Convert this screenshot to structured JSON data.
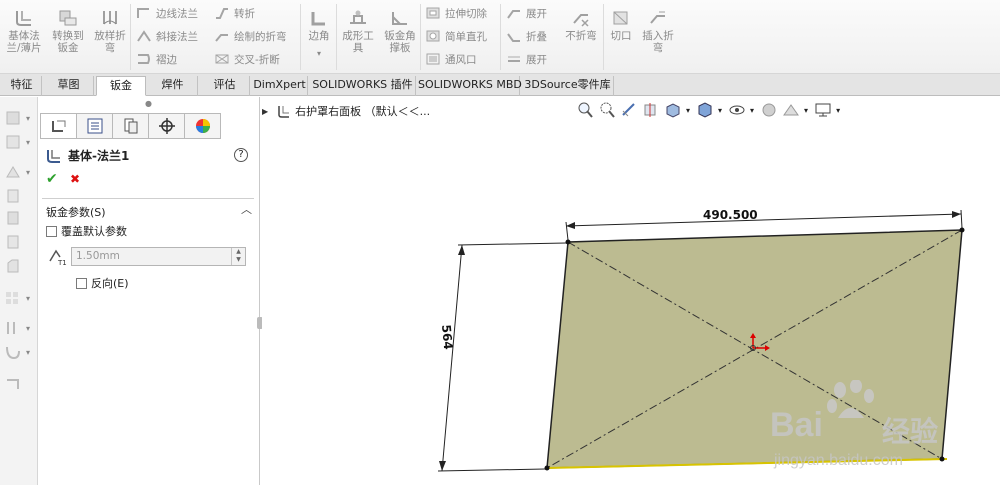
{
  "ribbon": {
    "big": [
      {
        "key": "base_flange",
        "label": "基体法\n兰/薄片"
      },
      {
        "key": "convert",
        "label": "转换到\n钣金"
      },
      {
        "key": "lofted",
        "label": "放样折\n弯"
      },
      {
        "key": "corners",
        "label": "边角"
      },
      {
        "key": "forming",
        "label": "成形工\n具"
      },
      {
        "key": "gusset",
        "label": "钣金角\n撑板"
      },
      {
        "key": "no_bends",
        "label": "不折弯"
      },
      {
        "key": "rip",
        "label": "切口"
      },
      {
        "key": "insert_bends",
        "label": "插入折\n弯"
      }
    ],
    "small": [
      {
        "key": "edge_flange",
        "label": "边线法兰"
      },
      {
        "key": "miter_flange",
        "label": "斜接法兰"
      },
      {
        "key": "hem",
        "label": "褶边"
      },
      {
        "key": "jog",
        "label": "转折"
      },
      {
        "key": "sketched_bend",
        "label": "绘制的折弯"
      },
      {
        "key": "cross_break",
        "label": "交叉-折断"
      },
      {
        "key": "extruded_cut",
        "label": "拉伸切除"
      },
      {
        "key": "simple_hole",
        "label": "简单直孔"
      },
      {
        "key": "vent",
        "label": "通风口"
      },
      {
        "key": "unfold",
        "label": "展开"
      },
      {
        "key": "fold",
        "label": "折叠"
      },
      {
        "key": "flatten",
        "label": "展开"
      }
    ]
  },
  "tabs": [
    {
      "label": "特征"
    },
    {
      "label": "草图"
    },
    {
      "label": "钣金",
      "active": true
    },
    {
      "label": "焊件"
    },
    {
      "label": "评估"
    },
    {
      "label": "DimXpert"
    },
    {
      "label": "SOLIDWORKS 插件"
    },
    {
      "label": "SOLIDWORKS MBD"
    },
    {
      "label": "3DSource零件库"
    }
  ],
  "property_manager": {
    "feature_title": "基体-法兰1",
    "help": "?",
    "ok_symbol": "✔",
    "cancel_symbol": "✖",
    "group_title": "钣金参数(S)",
    "override_label": "覆盖默认参数",
    "thickness_value": "1.50mm",
    "thickness_icon_label": "T1",
    "reverse_label": "反向(E)"
  },
  "viewport": {
    "tree_item": "右护罩右面板 （默认＜＜...",
    "dim_horizontal": "490.500",
    "dim_vertical": "564",
    "plate_color": "#bcbb91"
  },
  "watermark": {
    "brand": "Bai",
    "brand2": "经验",
    "url": "jingyan.baidu.com"
  }
}
